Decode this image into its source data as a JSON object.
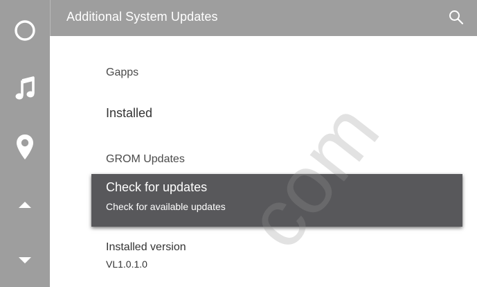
{
  "header": {
    "title": "Additional System Updates",
    "search_icon": "search-icon"
  },
  "rail": {
    "items": [
      {
        "icon": "home-circle-icon"
      },
      {
        "icon": "music-note-icon"
      },
      {
        "icon": "location-pin-icon"
      },
      {
        "icon": "arrow-up-icon"
      },
      {
        "icon": "arrow-down-icon"
      }
    ],
    "background": "#9e9e9e"
  },
  "list": {
    "gapps_category": "Gapps",
    "gapps_status": "Installed",
    "grom_category": "GROM Updates",
    "check_title": "Check  for updates",
    "check_summary": "Check for available updates",
    "version_title": "Installed version",
    "version_value": "VL1.0.1.0"
  },
  "watermark": "com",
  "colors": {
    "header_background": "#9e9e9e",
    "highlight_background": "#58585b",
    "text_primary": "#333333"
  }
}
